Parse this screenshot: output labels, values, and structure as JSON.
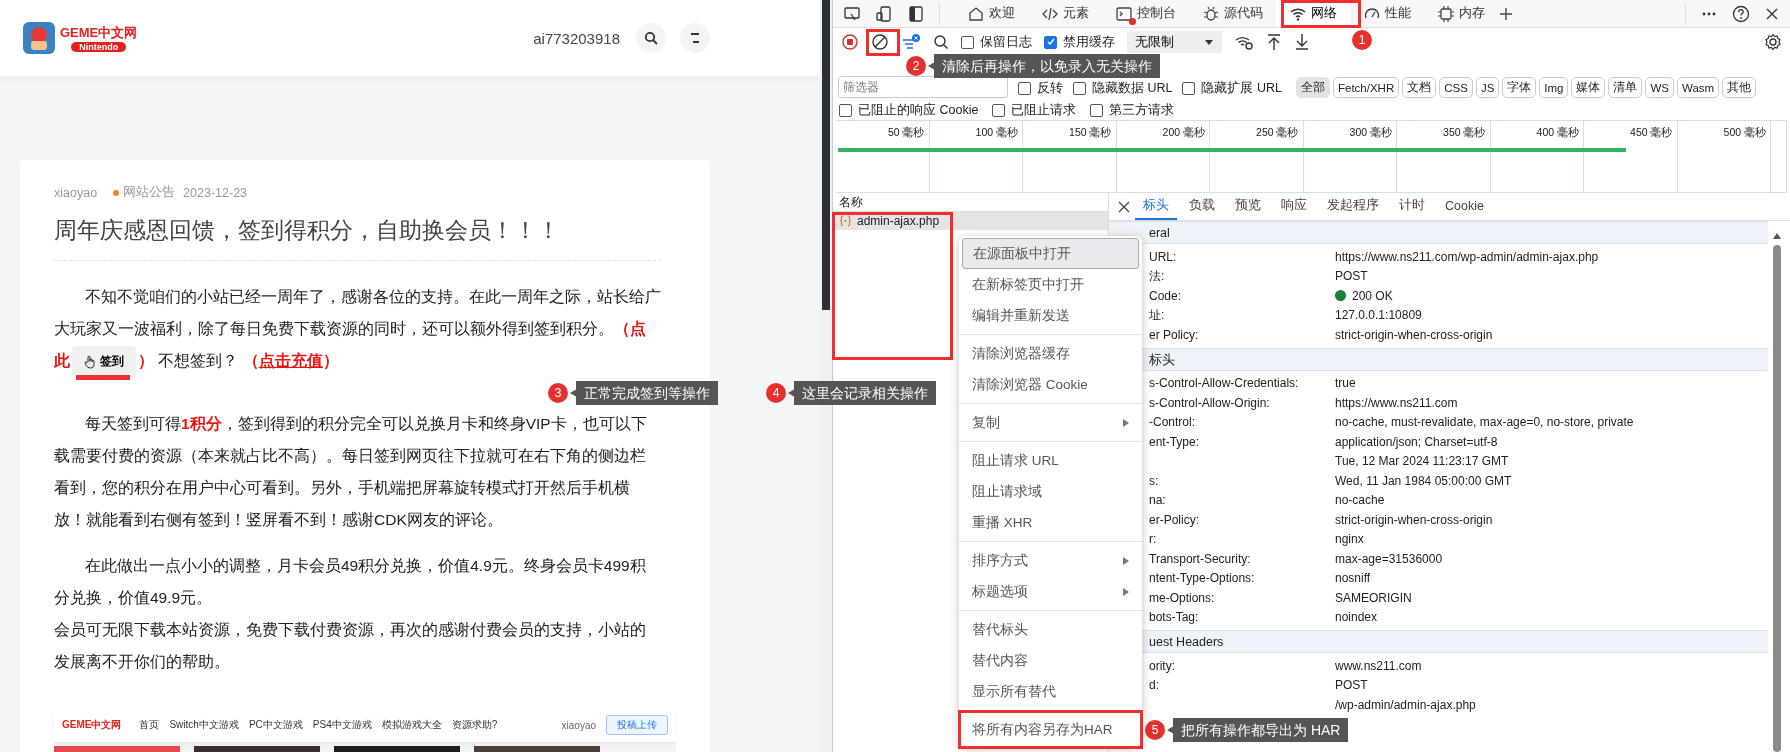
{
  "site": {
    "logo": {
      "title": "GEME中文网",
      "subtitle": "Nintendo"
    },
    "username": "ai773203918",
    "article": {
      "author": "xiaoyao",
      "category": "网站公告",
      "date": "2023-12-23",
      "title": "周年庆感恩回馈，签到得积分，自助换会员！！！",
      "paragraphs": [
        {
          "segments": [
            {
              "kind": "text",
              "text": "不知不觉咱们的小站已经一周年了，感谢各位的支持。在此一周年之际，站长给广大玩家又一波福利，除了每日免费下载资源的同时，还可以额外得到签到积分。"
            },
            {
              "kind": "emph",
              "text": "（点此"
            },
            {
              "kind": "button",
              "text": "签到"
            },
            {
              "kind": "emph",
              "text": "）"
            },
            {
              "kind": "text",
              "text": " 不想签到？ "
            },
            {
              "kind": "emph",
              "text": "（"
            },
            {
              "kind": "link",
              "text": "点击充值"
            },
            {
              "kind": "emph",
              "text": "）"
            }
          ]
        },
        {
          "segments": [
            {
              "kind": "text",
              "text": "每天签到可得"
            },
            {
              "kind": "emph",
              "text": "1积分"
            },
            {
              "kind": "text",
              "text": "，签到得到的积分完全可以兑换月卡和终身VIP卡，也可以下载需要付费的资源（本来就占比不高）。每日签到网页往下拉就可在右下角的侧边栏看到，您的积分在用户中心可看到。另外，手机端把屏幕旋转模式打开然后手机横放！就能看到右侧有签到！竖屏看不到！感谢CDK网友的评论。"
            }
          ]
        },
        {
          "segments": [
            {
              "kind": "text",
              "text": "在此做出一点小小的调整，月卡会员49积分兑换，价值4.9元。终身会员卡499积分兑换，价值49.9元。"
            },
            {
              "kind": "break"
            },
            {
              "kind": "text",
              "text": "会员可无限下载本站资源，免费下载付费资源，再次的感谢付费会员的支持，小站的发展离不开你们的帮助。"
            }
          ]
        }
      ],
      "embedded_screenshot": {
        "logo": "GEME中文网",
        "nav": [
          "首页",
          "Switch中文游戏",
          "PC中文游戏",
          "PS4中文游戏",
          "模拟游戏大全",
          "资源求助?"
        ],
        "user": "xiaoyao",
        "button": "投稿上传"
      }
    }
  },
  "devtools": {
    "tabs": [
      {
        "label": "欢迎",
        "selected": false,
        "badge": false
      },
      {
        "label": "元素",
        "selected": false,
        "badge": false
      },
      {
        "label": "控制台",
        "selected": false,
        "badge": true
      },
      {
        "label": "源代码",
        "selected": false,
        "badge": false
      },
      {
        "label": "网络",
        "selected": true,
        "badge": false
      },
      {
        "label": "性能",
        "selected": false,
        "badge": false
      },
      {
        "label": "内存",
        "selected": false,
        "badge": false
      }
    ],
    "toolbar": {
      "checkboxes": [
        {
          "label": "保留日志",
          "checked": false
        },
        {
          "label": "禁用缓存",
          "checked": true
        }
      ],
      "throttling": "无限制"
    },
    "filter": {
      "placeholder": "筛选器",
      "checkboxes": [
        {
          "label": "反转",
          "checked": false
        },
        {
          "label": "隐藏数据 URL",
          "checked": false
        },
        {
          "label": "隐藏扩展 URL",
          "checked": false
        }
      ],
      "types": [
        {
          "label": "全部",
          "selected": true
        },
        {
          "label": "Fetch/XHR",
          "selected": false
        },
        {
          "label": "文档",
          "selected": false
        },
        {
          "label": "CSS",
          "selected": false
        },
        {
          "label": "JS",
          "selected": false
        },
        {
          "label": "字体",
          "selected": false
        },
        {
          "label": "Img",
          "selected": false
        },
        {
          "label": "媒体",
          "selected": false
        },
        {
          "label": "清单",
          "selected": false
        },
        {
          "label": "WS",
          "selected": false
        },
        {
          "label": "Wasm",
          "selected": false
        },
        {
          "label": "其他",
          "selected": false
        }
      ]
    },
    "extra_checkboxes": [
      {
        "label": "已阻止的响应 Cookie",
        "checked": false
      },
      {
        "label": "已阻止请求",
        "checked": false
      },
      {
        "label": "第三方请求",
        "checked": false
      }
    ],
    "timeline": {
      "ticks": [
        "50 毫秒",
        "100 毫秒",
        "150 毫秒",
        "200 毫秒",
        "250 毫秒",
        "300 毫秒",
        "350 毫秒",
        "400 毫秒",
        "450 毫秒",
        "500 毫秒"
      ]
    },
    "requests": {
      "header": "名称",
      "rows": [
        {
          "name": "admin-ajax.php",
          "selected": true
        }
      ]
    },
    "detail": {
      "tabs": [
        {
          "label": "标头",
          "selected": true
        },
        {
          "label": "负载",
          "selected": false
        },
        {
          "label": "预览",
          "selected": false
        },
        {
          "label": "响应",
          "selected": false
        },
        {
          "label": "发起程序",
          "selected": false
        },
        {
          "label": "计时",
          "selected": false
        },
        {
          "label": "Cookie",
          "selected": false
        }
      ],
      "sections": [
        {
          "title": "eral",
          "rows": [
            {
              "name": "URL:",
              "value": "https://www.ns211.com/wp-admin/admin-ajax.php"
            },
            {
              "name": "法:",
              "value": "POST"
            },
            {
              "name": "Code:",
              "value": "200 OK",
              "color": "#188038"
            },
            {
              "name": "址:",
              "value": "127.0.0.1:10809"
            },
            {
              "name": "er Policy:",
              "value": "strict-origin-when-cross-origin"
            }
          ]
        },
        {
          "title": "标头",
          "rows": [
            {
              "name": "s-Control-Allow-Credentials:",
              "value": "true"
            },
            {
              "name": "s-Control-Allow-Origin:",
              "value": "https://www.ns211.com"
            },
            {
              "name": "-Control:",
              "value": "no-cache, must-revalidate, max-age=0, no-store, private"
            },
            {
              "name": "ent-Type:",
              "value": "application/json; Charset=utf-8"
            },
            {
              "value": "Tue, 12 Mar 2024 11:23:17 GMT"
            },
            {
              "name": "s:",
              "value": "Wed, 11 Jan 1984 05:00:00 GMT"
            },
            {
              "name": "na:",
              "value": "no-cache"
            },
            {
              "name": "er-Policy:",
              "value": "strict-origin-when-cross-origin"
            },
            {
              "name": "r:",
              "value": "nginx"
            },
            {
              "name": "Transport-Security:",
              "value": "max-age=31536000"
            },
            {
              "name": "ntent-Type-Options:",
              "value": "nosniff"
            },
            {
              "name": "me-Options:",
              "value": "SAMEORIGIN"
            },
            {
              "name": "bots-Tag:",
              "value": "noindex"
            }
          ]
        },
        {
          "title": "uest Headers",
          "rows": [
            {
              "name": "ority:",
              "value": "www.ns211.com"
            },
            {
              "name": "d:",
              "value": "POST"
            },
            {
              "value": "/wp-admin/admin-ajax.php"
            }
          ]
        }
      ]
    },
    "context_menu": {
      "groups": [
        {
          "items": [
            {
              "label": "在源面板中打开",
              "selected": true,
              "submenu": false
            },
            {
              "label": "在新标签页中打开",
              "selected": false,
              "submenu": false
            },
            {
              "label": "编辑并重新发送",
              "selected": false,
              "submenu": false
            }
          ]
        },
        {
          "items": [
            {
              "label": "清除浏览器缓存",
              "selected": false,
              "submenu": false
            },
            {
              "label": "清除浏览器 Cookie",
              "selected": false,
              "submenu": false
            }
          ]
        },
        {
          "items": [
            {
              "label": "复制",
              "selected": false,
              "submenu": true
            }
          ]
        },
        {
          "items": [
            {
              "label": "阻止请求 URL",
              "selected": false,
              "submenu": false
            },
            {
              "label": "阻止请求域",
              "selected": false,
              "submenu": false
            },
            {
              "label": "重播 XHR",
              "selected": false,
              "submenu": false
            }
          ]
        },
        {
          "items": [
            {
              "label": "排序方式",
              "selected": false,
              "submenu": true
            },
            {
              "label": "标题选项",
              "selected": false,
              "submenu": true
            }
          ]
        },
        {
          "items": [
            {
              "label": "替代标头",
              "selected": false,
              "submenu": false
            },
            {
              "label": "替代内容",
              "selected": false,
              "submenu": false
            },
            {
              "label": "显示所有替代",
              "selected": false,
              "submenu": false
            }
          ]
        },
        {
          "items": [
            {
              "label": "将所有内容另存为HAR",
              "selected": false,
              "submenu": false
            }
          ]
        }
      ]
    }
  },
  "annotations": [
    {
      "number": "1"
    },
    {
      "number": "2",
      "text": "清除后再操作，以免录入无关操作"
    },
    {
      "number": "3",
      "text": "正常完成签到等操作"
    },
    {
      "number": "4",
      "text": "这里会记录相关操作"
    },
    {
      "number": "5",
      "text": "把所有操作都导出为 HAR"
    }
  ]
}
